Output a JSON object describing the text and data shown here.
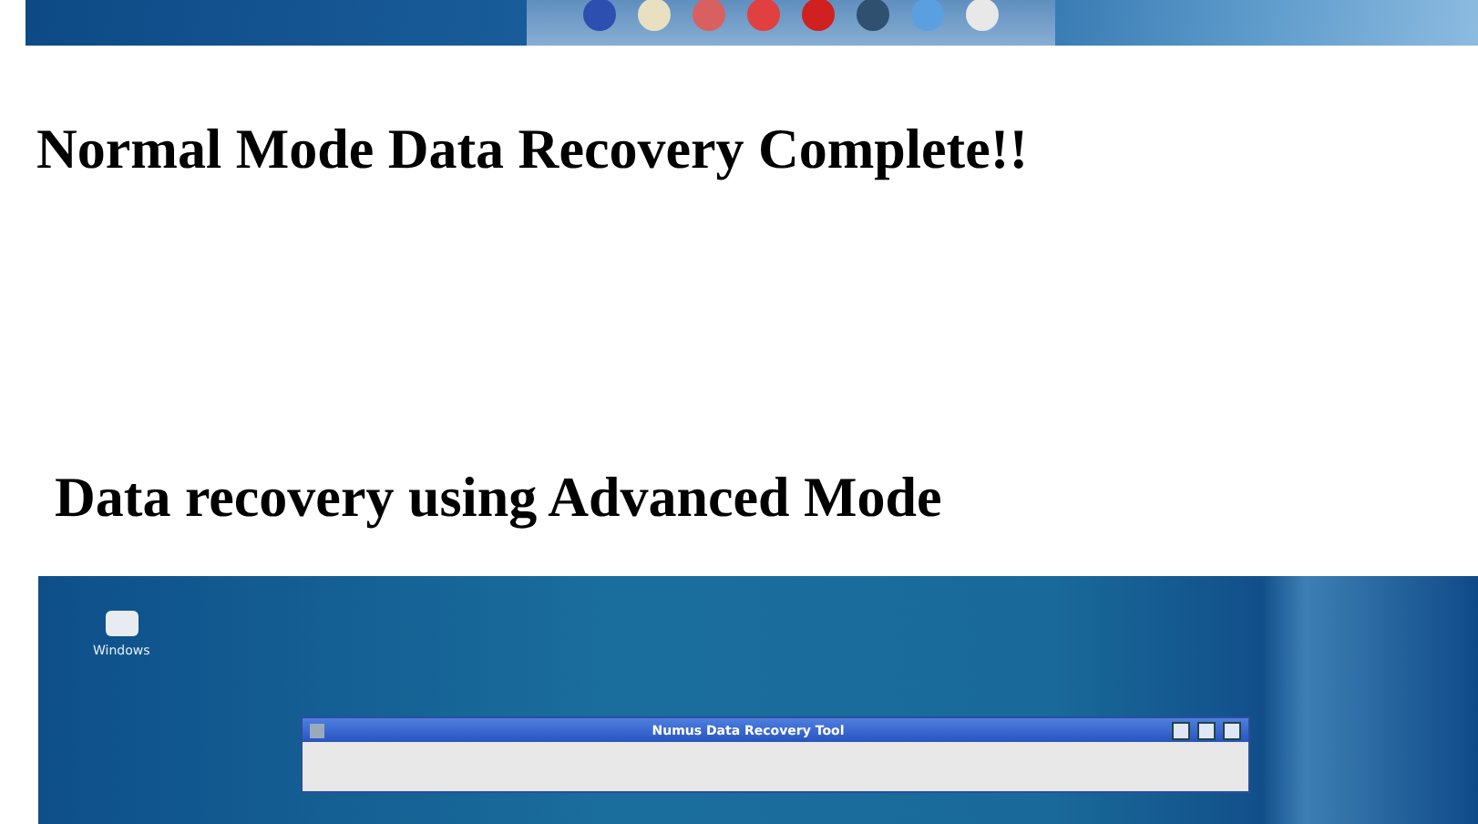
{
  "headings": [
    {
      "text": "Normal Mode Data Recovery Complete!!"
    },
    {
      "text": "Data recovery using Advanced Mode"
    }
  ],
  "advanced_screenshot": {
    "desktop_icons": [
      {
        "label": "Windows"
      }
    ],
    "window": {
      "title": "Numus Data Recovery Tool"
    }
  }
}
